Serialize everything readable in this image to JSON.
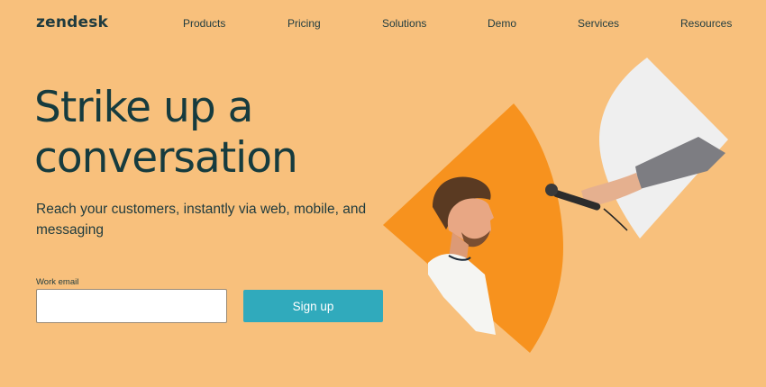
{
  "brand": {
    "logo_text": "zendesk"
  },
  "nav": {
    "items": [
      {
        "label": "Products"
      },
      {
        "label": "Pricing"
      },
      {
        "label": "Solutions"
      },
      {
        "label": "Demo"
      },
      {
        "label": "Services"
      },
      {
        "label": "Resources"
      }
    ]
  },
  "hero": {
    "headline": "Strike up a conversation",
    "subhead": "Reach your customers, instantly via web, mobile, and messaging",
    "email_label": "Work email",
    "email_value": "",
    "email_placeholder": "",
    "signup_label": "Sign up",
    "image_icon": "interview-illustration"
  },
  "colors": {
    "background": "#f8c07c",
    "text": "#17363a",
    "button": "#30aabc",
    "accent_orange": "#f7921e",
    "panel_white": "#efefef"
  }
}
